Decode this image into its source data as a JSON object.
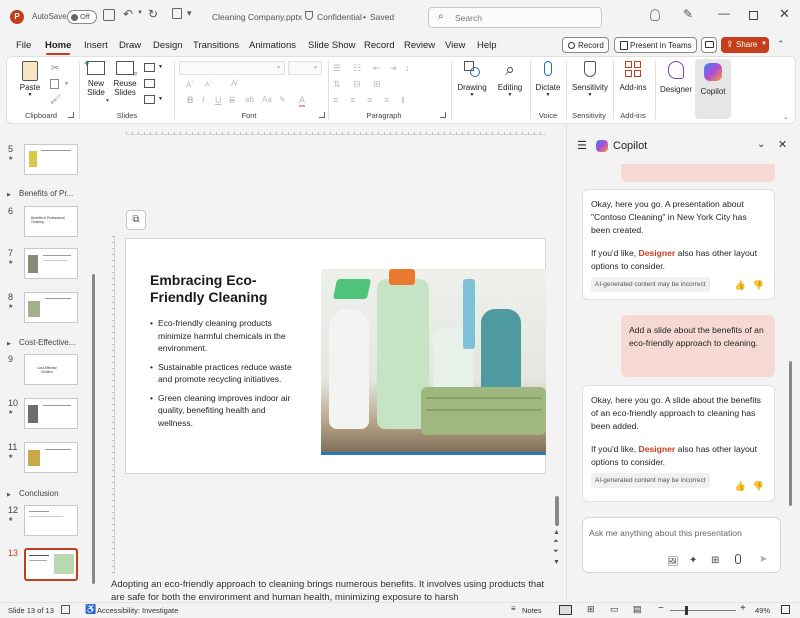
{
  "titlebar": {
    "autosave_label": "AutoSave",
    "autosave_state": "Off",
    "filename": "Cleaning Company.pptx",
    "sensitivity": "Confidential",
    "save_state": "Saved",
    "search_placeholder": "Search"
  },
  "tabs": [
    "File",
    "Home",
    "Insert",
    "Draw",
    "Design",
    "Transitions",
    "Animations",
    "Slide Show",
    "Record",
    "Review",
    "View",
    "Help"
  ],
  "active_tab": "Home",
  "tab_actions": {
    "record": "Record",
    "present": "Present in Teams",
    "share": "Share"
  },
  "ribbon": {
    "paste": "Paste",
    "clipboard": "Clipboard",
    "new_slide_1": "New",
    "new_slide_2": "Slide",
    "reuse_1": "Reuse",
    "reuse_2": "Slides",
    "slides": "Slides",
    "font": "Font",
    "paragraph": "Paragraph",
    "drawing": "Drawing",
    "editing": "Editing",
    "dictate": "Dictate",
    "voice": "Voice",
    "sensitivity": "Sensitivity",
    "sensitivity_group": "Sensitivity",
    "addins": "Add-ins",
    "addins_group": "Add-ins",
    "designer": "Designer",
    "copilot": "Copilot"
  },
  "thumbnails": {
    "sections": {
      "s1": "Benefits of Pr...",
      "s2": "Cost-Effective...",
      "s3": "Conclusion"
    },
    "nums": {
      "n5": "5",
      "n6": "6",
      "n7": "7",
      "n8": "8",
      "n9": "9",
      "n10": "10",
      "n11": "11",
      "n12": "12",
      "n13": "13"
    },
    "t6_title": "Benefits of Professional Cleaning",
    "t9_title": "Cost-Effective Solution"
  },
  "slide": {
    "title": "Embracing Eco-Friendly Cleaning",
    "bullets": [
      "Eco-friendly cleaning products minimize harmful chemicals in the environment.",
      "Sustainable practices reduce waste and promote recycling initiatives.",
      "Green cleaning improves indoor air quality, benefiting health and wellness."
    ]
  },
  "notes": "Adopting an eco-friendly approach to cleaning brings numerous benefits. It involves using products that are safe for both the environment and human health, minimizing exposure to harsh",
  "copilot": {
    "title": "Copilot",
    "msg1_a": "Okay, here you go. A presentation about \"Contoso Cleaning\" in New York City has been created.",
    "msg1_b_pre": "If you'd like, ",
    "msg1_b_link": "Designer",
    "msg1_b_post": " also has other layout options to consider.",
    "ai_tag": "AI-generated content may be incorrect",
    "user_msg": "Add a slide about the benefits of an eco-friendly approach to cleaning.",
    "msg2_a": "Okay, here you go. A slide about the benefits of an eco-friendly approach to cleaning has been added.",
    "msg2_b_pre": "If you'd like, ",
    "msg2_b_link": "Designer",
    "msg2_b_post": " also has other layout options to consider.",
    "input_placeholder": "Ask me anything about this presentation"
  },
  "status": {
    "slide_info": "Slide 13 of 13",
    "accessibility": "Accessibility: Investigate",
    "notes": "Notes",
    "zoom": "49%"
  },
  "colors": {
    "accent": "#c43e1c",
    "user_bubble": "#f6d9d3",
    "link": "#c43e1c"
  }
}
